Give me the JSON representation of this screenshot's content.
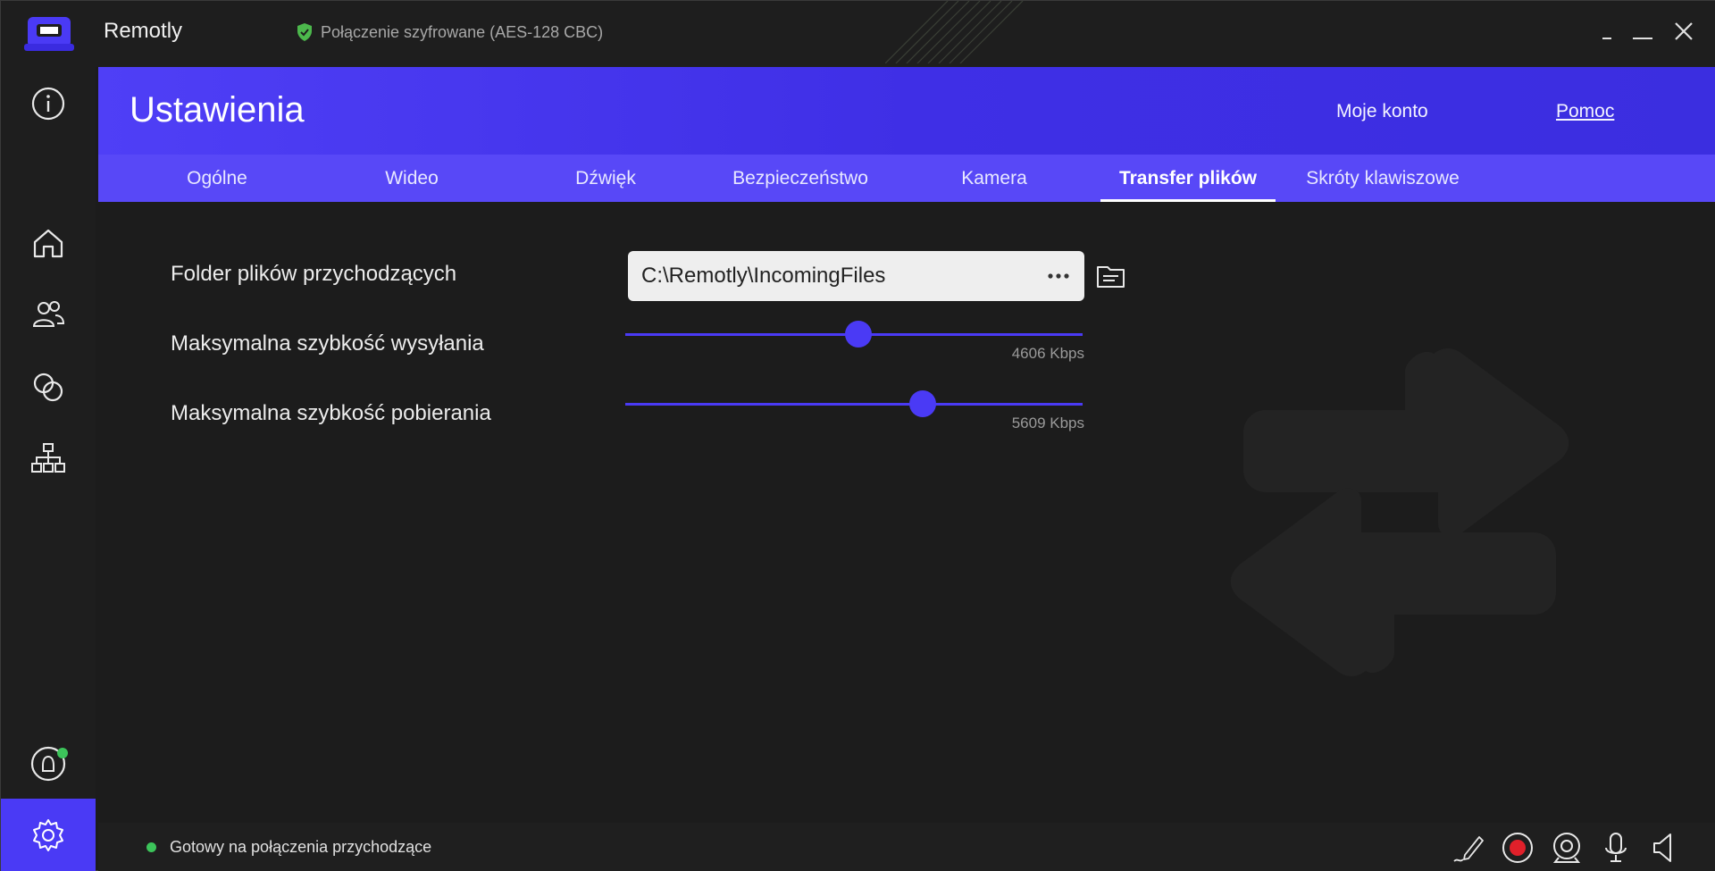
{
  "app": {
    "title": "Remotly",
    "connection_status": "Połączenie szyfrowane (AES-128 CBC)"
  },
  "window_controls": [
    "minimize",
    "maximize",
    "close"
  ],
  "sidebar": {
    "items": [
      {
        "icon": "info-icon"
      },
      {
        "icon": "home-icon"
      },
      {
        "icon": "contacts-icon"
      },
      {
        "icon": "sessions-icon"
      },
      {
        "icon": "devices-icon"
      },
      {
        "icon": "account-icon"
      },
      {
        "icon": "settings-icon",
        "active": true
      }
    ]
  },
  "header": {
    "title": "Ustawienia",
    "account_link": "Moje konto",
    "help_link": "Pomoc"
  },
  "tabs": [
    {
      "label": "Ogólne"
    },
    {
      "label": "Wideo"
    },
    {
      "label": "Dźwięk"
    },
    {
      "label": "Bezpieczeństwo"
    },
    {
      "label": "Kamera"
    },
    {
      "label": "Transfer plików",
      "active": true
    },
    {
      "label": "Skróty klawiszowe"
    }
  ],
  "settings": {
    "folder_label": "Folder plików przychodzących",
    "folder_path": "C:\\Remotly\\IncomingFiles",
    "upload_label": "Maksymalna szybkość wysyłania",
    "upload_value": "4606 Kbps",
    "upload_fraction": 0.51,
    "download_label": "Maksymalna szybkość pobierania",
    "download_value": "5609 Kbps",
    "download_fraction": 0.65
  },
  "statusbar": {
    "text": "Gotowy na połączenia przychodzące",
    "tools": [
      "pen-icon",
      "record-icon",
      "webcam-icon",
      "microphone-icon",
      "speaker-icon"
    ]
  },
  "colors": {
    "accent": "#4a3af5",
    "online": "#3cc45a",
    "record": "#e0202a"
  }
}
